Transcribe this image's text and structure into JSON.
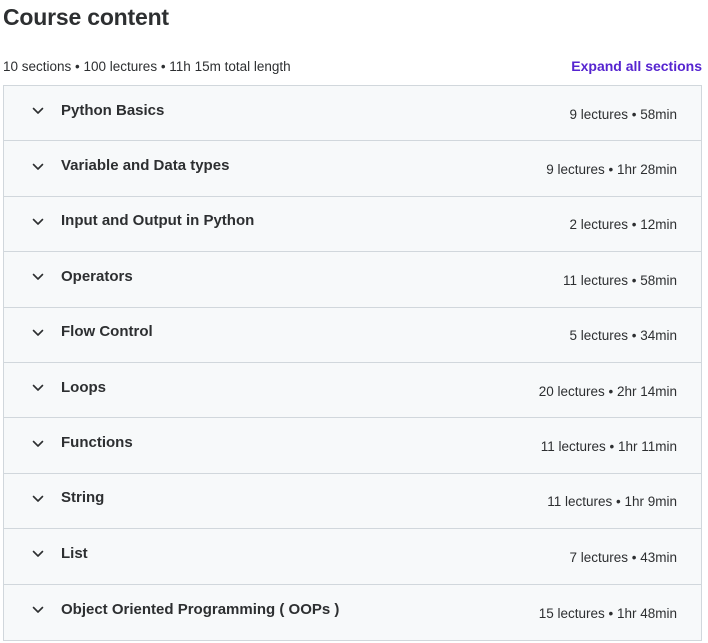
{
  "header": {
    "title": "Course content",
    "summary": "10 sections • 100 lectures • 11h 15m total length",
    "expand_all_label": "Expand all sections"
  },
  "icons": {
    "section_toggle": "chevron-down-icon"
  },
  "colors": {
    "accent": "#5624d0",
    "text": "#2d2f31",
    "row_background": "#f7f9fa",
    "border": "#d1d7dc"
  },
  "sections": [
    {
      "title": "Python Basics",
      "meta": "9 lectures • 58min"
    },
    {
      "title": "Variable and Data types",
      "meta": "9 lectures • 1hr 28min"
    },
    {
      "title": "Input and Output in Python",
      "meta": "2 lectures • 12min"
    },
    {
      "title": "Operators",
      "meta": "11 lectures • 58min"
    },
    {
      "title": "Flow Control",
      "meta": "5 lectures • 34min"
    },
    {
      "title": "Loops",
      "meta": "20 lectures • 2hr 14min"
    },
    {
      "title": "Functions",
      "meta": "11 lectures • 1hr 11min"
    },
    {
      "title": "String",
      "meta": "11 lectures • 1hr 9min"
    },
    {
      "title": "List",
      "meta": "7 lectures • 43min"
    },
    {
      "title": "Object Oriented Programming ( OOPs )",
      "meta": "15 lectures • 1hr 48min"
    }
  ]
}
